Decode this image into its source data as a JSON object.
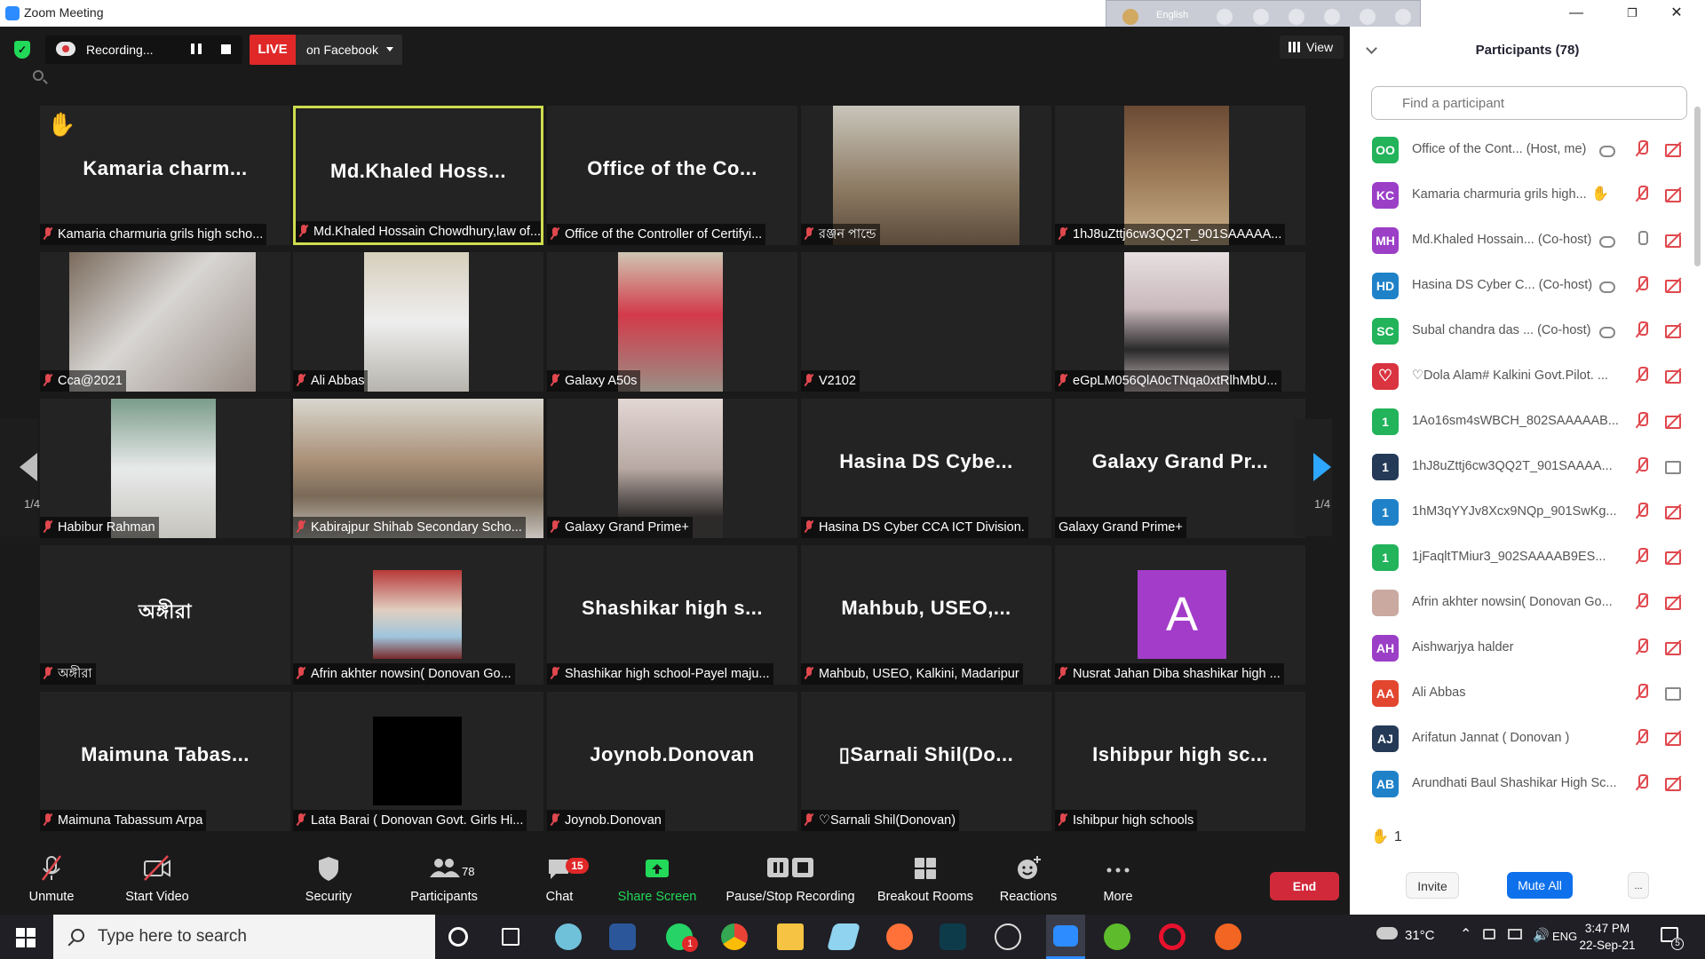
{
  "window": {
    "title": "Zoom Meeting",
    "minimize": "—",
    "restore": "❐",
    "close": "✕"
  },
  "langbar": {
    "language": "English"
  },
  "top": {
    "recording_label": "Recording...",
    "live_label": "LIVE",
    "live_target": "on Facebook",
    "view_label": "View"
  },
  "gallery": {
    "page_left": "1/4",
    "page_right": "1/4",
    "tiles": [
      {
        "big": "Kamaria  charm...",
        "caption": "Kamaria charmuria grils high scho...",
        "hand": "✋"
      },
      {
        "big": "Md.Khaled  Hoss...",
        "caption": "Md.Khaled Hossain Chowdhury,law of..."
      },
      {
        "big": "Office  of  the  Co...",
        "caption": "Office of the Controller of Certifyi..."
      },
      {
        "caption": "রঞ্জন পান্ডে"
      },
      {
        "caption": "1hJ8uZttj6cw3QQ2T_901SAAAAA..."
      },
      {
        "caption": "Cca@2021"
      },
      {
        "caption": "Ali Abbas"
      },
      {
        "caption": "Galaxy A50s"
      },
      {
        "caption": "V2102"
      },
      {
        "caption": "eGpLM056QlA0cTNqa0xtRlhMbU..."
      },
      {
        "caption": "Habibur Rahman"
      },
      {
        "caption": "Kabirajpur Shihab Secondary Scho..."
      },
      {
        "caption": "Galaxy Grand Prime+"
      },
      {
        "big": "Hasina  DS  Cybe...",
        "caption": "Hasina DS Cyber CCA ICT Division."
      },
      {
        "big": "Galaxy  Grand  Pr...",
        "caption": "Galaxy Grand Prime+"
      },
      {
        "big": "অঙ্গীরা",
        "caption": "অঙ্গীরা"
      },
      {
        "caption": "Afrin akhter nowsin( Donovan Go..."
      },
      {
        "big": "Shashikar  high  s...",
        "caption": "Shashikar high school-Payel maju..."
      },
      {
        "big": "Mahbub,  USEO,...",
        "caption": "Mahbub, USEO, Kalkini, Madaripur"
      },
      {
        "avatar": "A",
        "caption": "Nusrat Jahan Diba shashikar high ..."
      },
      {
        "big": "Maimuna  Tabas...",
        "caption": "Maimuna Tabassum Arpa"
      },
      {
        "caption": "Lata Barai ( Donovan Govt. Girls Hi..."
      },
      {
        "big": "Joynob.Donovan",
        "caption": "Joynob.Donovan"
      },
      {
        "big": "▯Sarnali  Shil(Do...",
        "caption": "Sarnali Shil(Donovan)"
      },
      {
        "big": "Ishibpur  high  sc...",
        "caption": "Ishibpur high schools"
      }
    ]
  },
  "toolbar": {
    "unmute": "Unmute",
    "start_video": "Start Video",
    "security": "Security",
    "participants": "Participants",
    "participants_count": "78",
    "chat": "Chat",
    "chat_badge": "15",
    "share_screen": "Share Screen",
    "pause_stop": "Pause/Stop Recording",
    "breakout": "Breakout Rooms",
    "reactions": "Reactions",
    "more": "More",
    "end": "End"
  },
  "panel": {
    "title": "Participants (78)",
    "search_placeholder": "Find a participant",
    "participants": [
      {
        "initials": "OO",
        "color": "#22b35b",
        "name": "Office of the Cont...  (Host, me)"
      },
      {
        "initials": "KC",
        "color": "#9b3fc7",
        "name": "Kamaria charmuria grils high..."
      },
      {
        "initials": "MH",
        "color": "#9b3fc7",
        "name": "Md.Khaled Hossain...  (Co-host)"
      },
      {
        "initials": "HD",
        "color": "#1f82c9",
        "name": "Hasina DS Cyber C...  (Co-host)"
      },
      {
        "initials": "SC",
        "color": "#22b35b",
        "name": "Subal chandra das ...  (Co-host)"
      },
      {
        "initials": "",
        "color": "#d9343f",
        "name": "♡Dola Alam# Kalkini Govt.Pilot. ..."
      },
      {
        "initials": "1",
        "color": "#22b35b",
        "name": "1Ao16sm4sWBCH_802SAAAAAB..."
      },
      {
        "initials": "1",
        "color": "#243a57",
        "name": "1hJ8uZttj6cw3QQ2T_901SAAAA..."
      },
      {
        "initials": "1",
        "color": "#1f82c9",
        "name": "1hM3qYYJv8Xcx9NQp_901SwKg..."
      },
      {
        "initials": "1",
        "color": "#22b35b",
        "name": "1jFaqltTMiur3_902SAAAAB9ES..."
      },
      {
        "initials": "",
        "color": "#c9a9a0",
        "name": "Afrin akhter nowsin( Donovan Go..."
      },
      {
        "initials": "AH",
        "color": "#9b3fc7",
        "name": "Aishwarjya halder"
      },
      {
        "initials": "AA",
        "color": "#e2462f",
        "name": "Ali Abbas"
      },
      {
        "initials": "AJ",
        "color": "#243a57",
        "name": "Arifatun Jannat ( Donovan )"
      },
      {
        "initials": "AB",
        "color": "#1f82c9",
        "name": "Arundhati Baul Shashikar High Sc..."
      }
    ],
    "raised_hands": "1",
    "invite": "Invite",
    "mute_all": "Mute All",
    "more": "..."
  },
  "taskbar": {
    "search_placeholder": "Type here to search",
    "weather": "31°C",
    "lang": "ENG",
    "time": "3:47 PM",
    "date": "22-Sep-21",
    "notif": "5",
    "whatsapp_badge": "1"
  }
}
